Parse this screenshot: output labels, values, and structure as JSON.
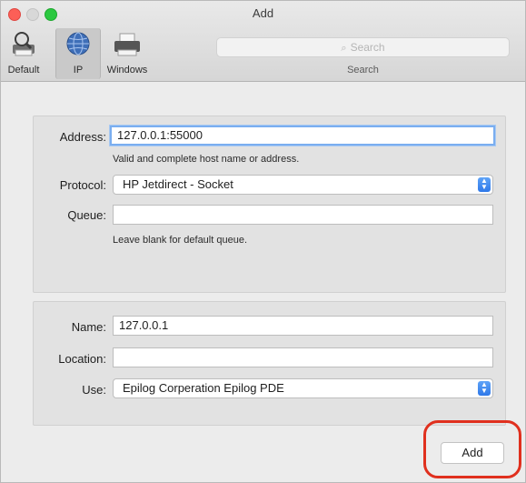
{
  "window": {
    "title": "Add"
  },
  "toolbar": {
    "items": [
      {
        "label": "Default",
        "icon": "printer-magnifier-icon"
      },
      {
        "label": "IP",
        "icon": "globe-icon"
      },
      {
        "label": "Windows",
        "icon": "windows-printer-icon"
      }
    ],
    "selected": "IP"
  },
  "search": {
    "placeholder": "Search",
    "caption": "Search"
  },
  "form": {
    "address": {
      "label": "Address:",
      "value": "127.0.0.1:55000",
      "hint": "Valid and complete host name or address."
    },
    "protocol": {
      "label": "Protocol:",
      "value": "HP Jetdirect - Socket"
    },
    "queue": {
      "label": "Queue:",
      "value": "",
      "hint": "Leave blank for default queue."
    },
    "name": {
      "label": "Name:",
      "value": "127.0.0.1"
    },
    "location": {
      "label": "Location:",
      "value": ""
    },
    "use": {
      "label": "Use:",
      "value": "Epilog Corperation Epilog PDE"
    }
  },
  "actions": {
    "add_label": "Add"
  },
  "colors": {
    "highlight": "#e0301e",
    "focus_ring": "#7aaef0",
    "popup_accent": "#2e78e9"
  }
}
